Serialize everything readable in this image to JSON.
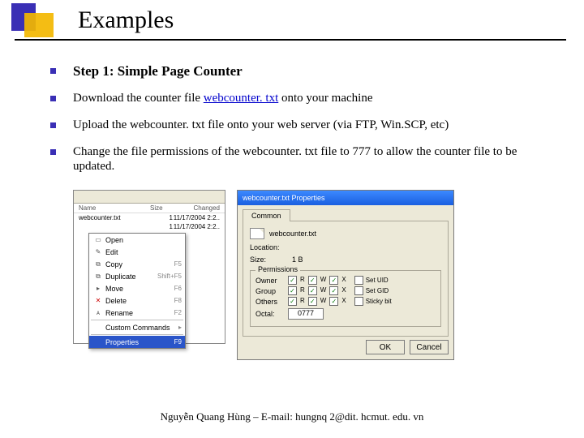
{
  "title": "Examples",
  "bullets": [
    {
      "kind": "heading",
      "text": "Step 1: Simple Page Counter"
    },
    {
      "kind": "para",
      "pre": "Download the counter file ",
      "link": "webcounter. txt",
      "post": " onto your machine"
    },
    {
      "kind": "para",
      "text": "Upload the webcounter. txt file onto your web server (via FTP, Win.SCP, etc)"
    },
    {
      "kind": "para",
      "text": "Change the file permissions of the webcounter. txt file to 777 to allow the counter file to be updated."
    }
  ],
  "ctx": {
    "columns": {
      "name": "Name",
      "size": "Size",
      "changed": "Changed"
    },
    "rows": [
      {
        "name": "webcounter.txt",
        "size": "1",
        "changed": "11/17/2004 2:2.."
      },
      {
        "name": "",
        "size": "1",
        "changed": "11/17/2004 2:2.."
      }
    ],
    "menu": [
      {
        "icon": "▭",
        "label": "Open",
        "shortcut": ""
      },
      {
        "icon": "✎",
        "label": "Edit",
        "shortcut": ""
      },
      {
        "icon": "⧉",
        "label": "Copy",
        "shortcut": "F5"
      },
      {
        "icon": "⧉",
        "label": "Duplicate",
        "shortcut": "Shift+F5"
      },
      {
        "icon": "▸",
        "label": "Move",
        "shortcut": "F6"
      },
      {
        "icon": "✕",
        "label": "Delete",
        "shortcut": "F8",
        "danger": true
      },
      {
        "icon": "ᴀ",
        "label": "Rename",
        "shortcut": "F2"
      },
      {
        "sep": true
      },
      {
        "icon": "",
        "label": "Custom Commands",
        "shortcut": "▸"
      },
      {
        "sep": true
      },
      {
        "icon": "",
        "label": "Properties",
        "shortcut": "F9",
        "selected": true
      }
    ]
  },
  "props": {
    "title": "webcounter.txt Properties",
    "tab": "Common",
    "filename": "webcounter.txt",
    "location_label": "Location:",
    "size_label": "Size:",
    "size_value": "1 B",
    "perm_legend": "Permissions",
    "rows": [
      {
        "who": "Owner",
        "r": true,
        "w": true,
        "x": true,
        "extra": "Set UID"
      },
      {
        "who": "Group",
        "r": true,
        "w": true,
        "x": true,
        "extra": "Set GID"
      },
      {
        "who": "Others",
        "r": true,
        "w": true,
        "x": true,
        "extra": "Sticky bit"
      }
    ],
    "labels": {
      "r": "R",
      "w": "W",
      "x": "X"
    },
    "octal_label": "Octal:",
    "octal": "0777",
    "ok": "OK",
    "cancel": "Cancel"
  },
  "footer": "Nguyễn Quang Hùng – E-mail: hungnq 2@dit. hcmut. edu. vn"
}
